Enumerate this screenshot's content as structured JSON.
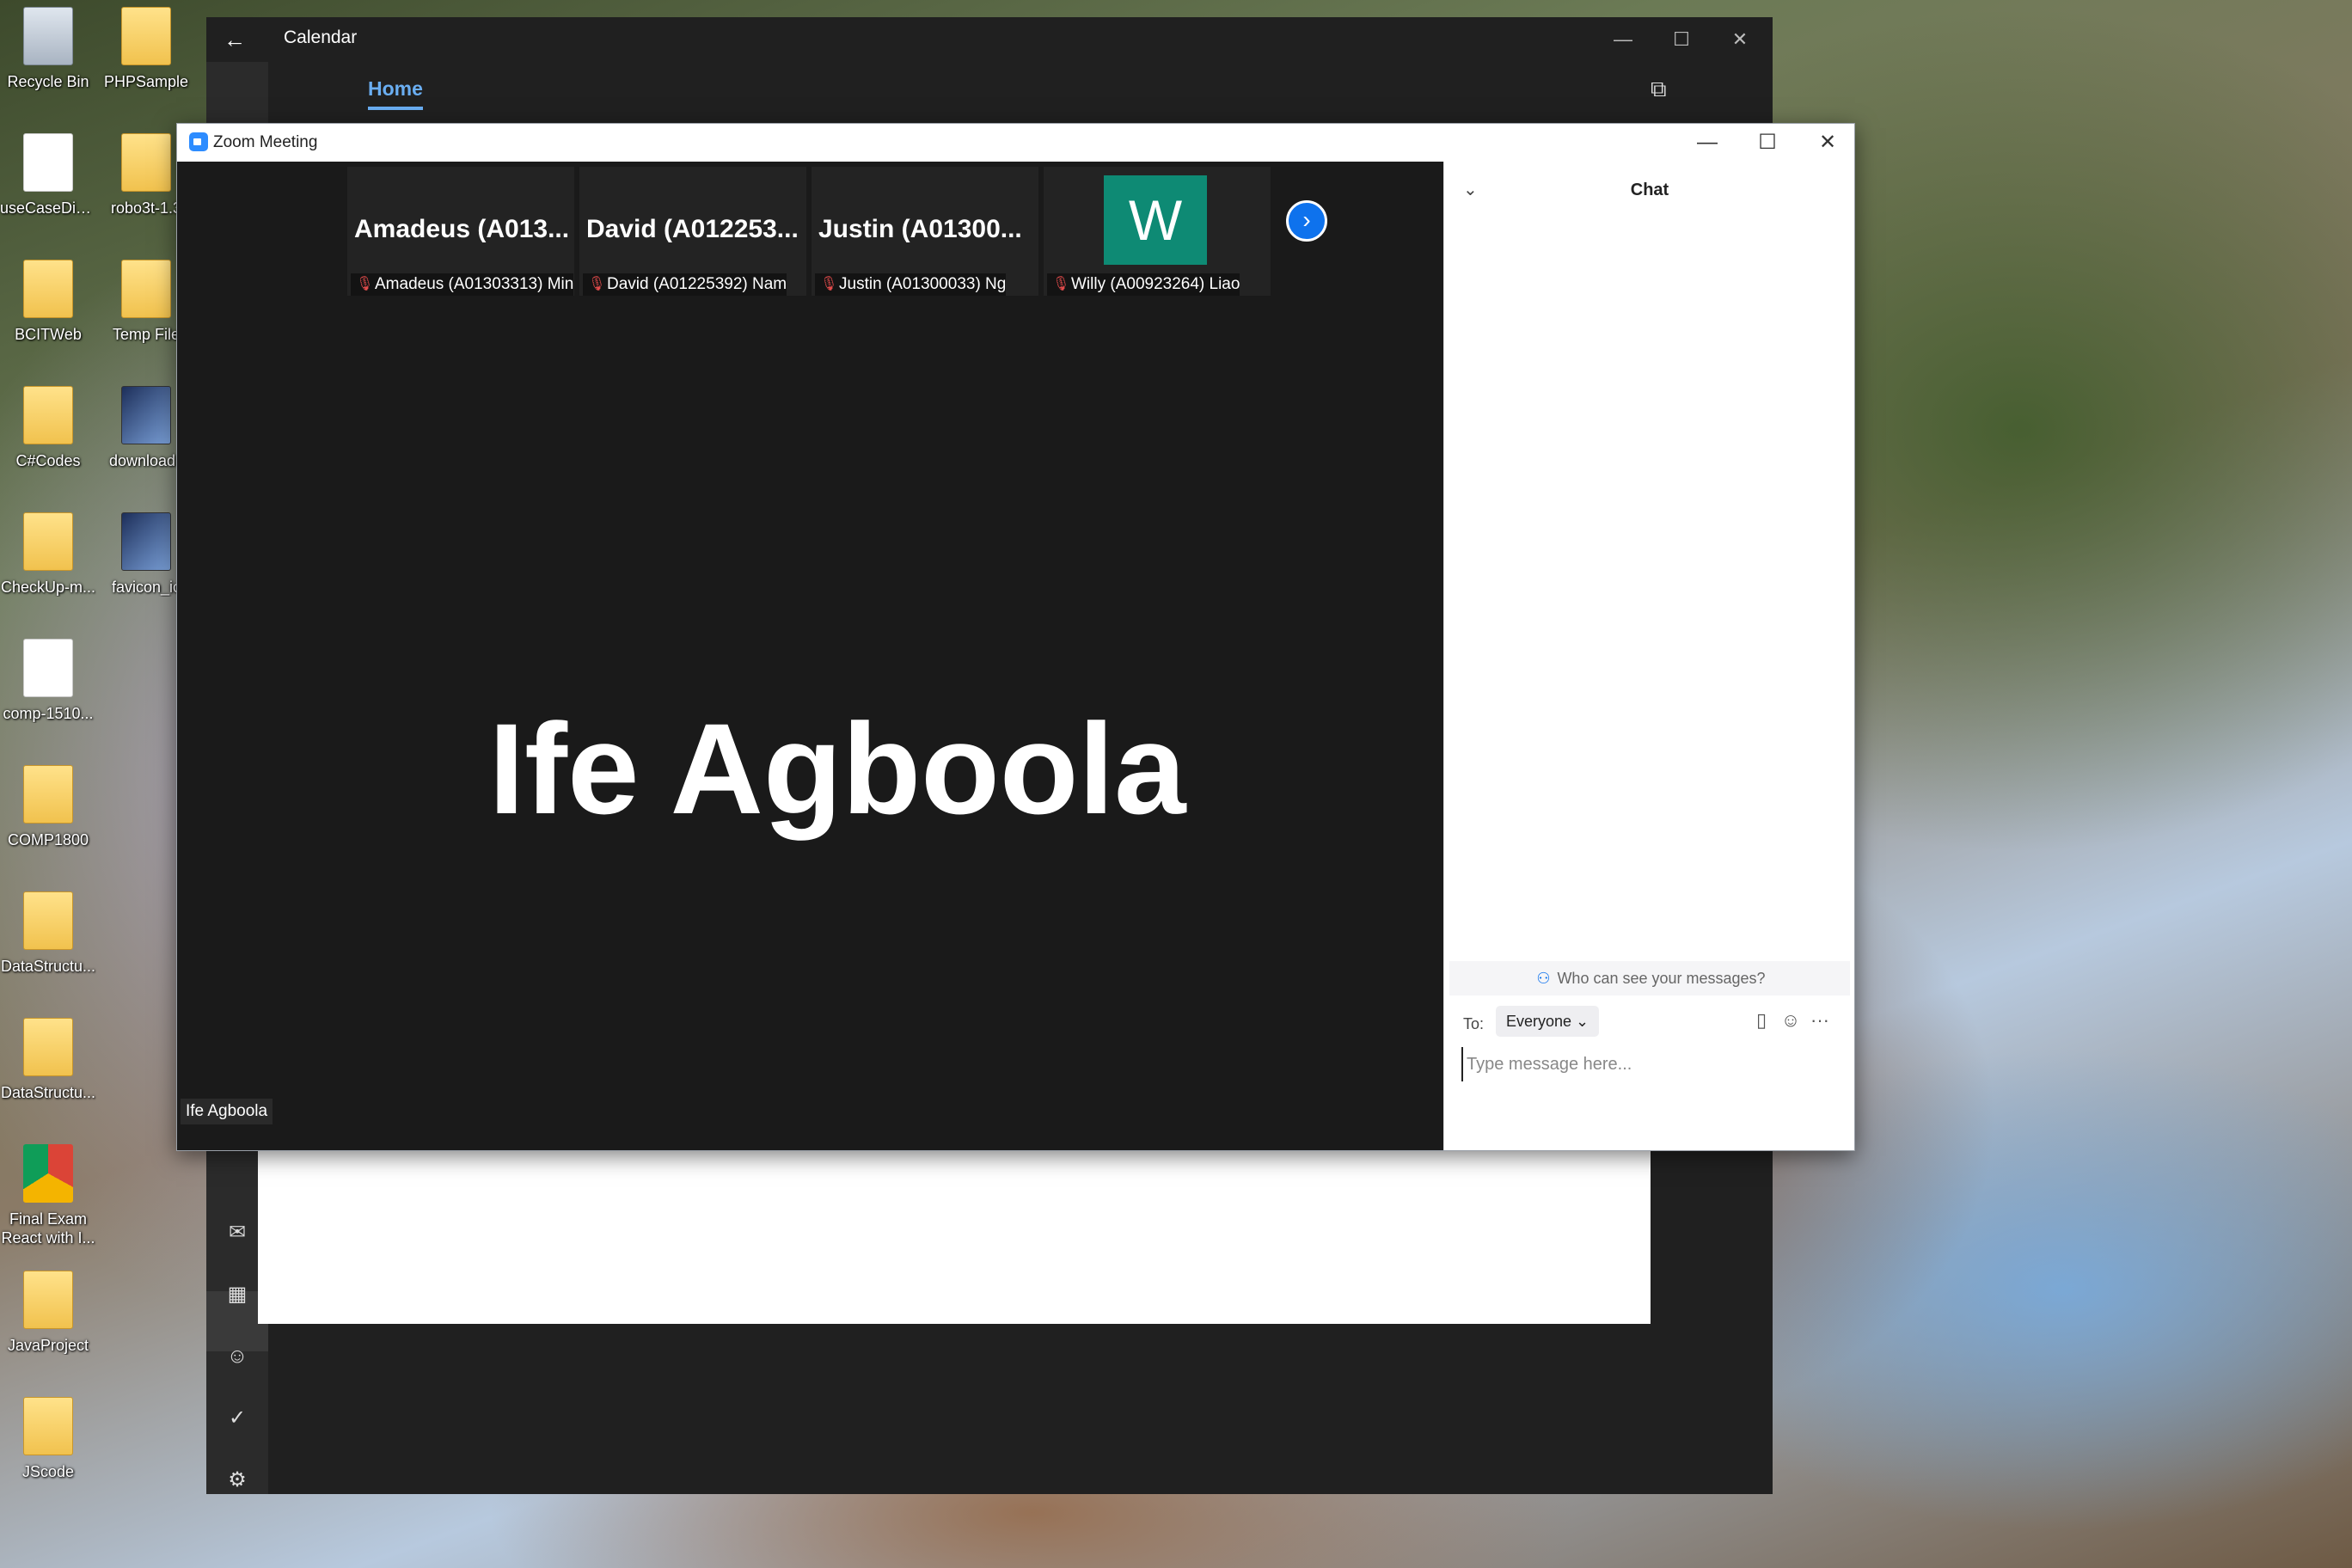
{
  "desktop": {
    "icons": [
      {
        "label": "Recycle Bin",
        "icon": "recycle-bin-icon"
      },
      {
        "label": "PHPSample",
        "icon": "folder-icon"
      },
      {
        "label": "useCaseDia...",
        "icon": "file-icon"
      },
      {
        "label": "robo3t-1.3",
        "icon": "folder-icon"
      },
      {
        "label": "BCITWeb",
        "icon": "folder-icon"
      },
      {
        "label": "Temp File",
        "icon": "folder-icon"
      },
      {
        "label": "C#Codes",
        "icon": "folder-icon"
      },
      {
        "label": "download.j",
        "icon": "image-file-icon"
      },
      {
        "label": "CheckUp-m...",
        "icon": "folder-icon"
      },
      {
        "label": "favicon_ic",
        "icon": "image-file-icon"
      },
      {
        "label": "comp-1510...",
        "icon": "file-icon"
      },
      {
        "label": "COMP1800",
        "icon": "folder-icon"
      },
      {
        "label": "DataStructu...",
        "icon": "folder-icon"
      },
      {
        "label": "DataStructu...",
        "icon": "folder-icon"
      },
      {
        "label": "Final Exam React with I...",
        "icon": "chrome-shortcut-icon"
      },
      {
        "label": "JavaProject",
        "icon": "folder-icon"
      },
      {
        "label": "JScode",
        "icon": "folder-icon"
      }
    ]
  },
  "calendar": {
    "title": "Calendar",
    "back_icon": "←",
    "minimize": "—",
    "maximize": "☐",
    "close": "✕",
    "tab_home": "Home",
    "popout_icon": "⧉",
    "side_icons": {
      "mail": "✉",
      "calendar": "▦",
      "people": "☺",
      "todo": "✓",
      "settings": "⚙"
    }
  },
  "zoom": {
    "title": "Zoom Meeting",
    "minimize": "—",
    "maximize": "☐",
    "close": "✕",
    "accent": "#0e72ed",
    "participants": [
      {
        "big_name": "Amadeus  (A013...",
        "label": "Amadeus (A01303313) Min"
      },
      {
        "big_name": "David  (A012253...",
        "label": "David (A01225392) Nam"
      },
      {
        "big_name": "Justin  (A01300...",
        "label": "Justin (A01300033) Ng"
      },
      {
        "avatar_letter": "W",
        "avatar_color": "#0e8a74",
        "label": "Willy (A00923264) Liao"
      }
    ],
    "next_arrow": "›",
    "speaker_name": "Ife Agboola",
    "speaker_label": "Ife Agboola"
  },
  "chat": {
    "collapse_icon": "⌄",
    "title": "Chat",
    "who_icon": "⚇",
    "who_text": "Who can see your messages?",
    "to_label": "To:",
    "to_value": "Everyone ⌄",
    "file_icon": "▯",
    "emoji_icon": "☺",
    "more_icon": "···",
    "input_placeholder": "Type message here..."
  }
}
